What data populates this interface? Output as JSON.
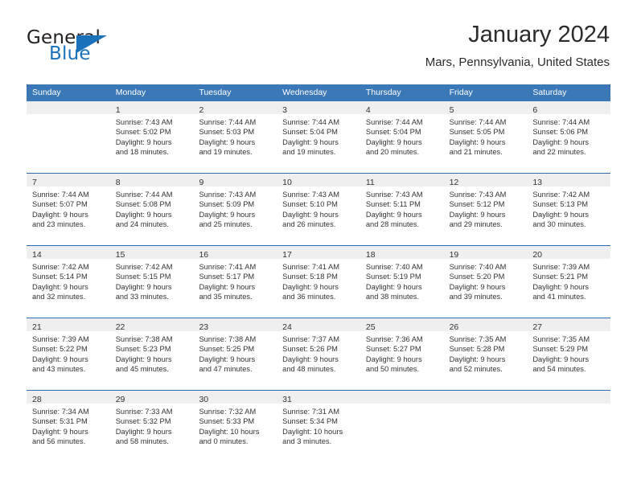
{
  "brand": {
    "name_top": "General",
    "name_bottom": "Blue",
    "triangle_icon": "triangle-icon",
    "accent_color": "#1b72bb"
  },
  "header": {
    "title": "January 2024",
    "subtitle": "Mars, Pennsylvania, United States"
  },
  "calendar": {
    "header_bg": "#3b78b8",
    "daynum_bg": "#efefef",
    "row_separator": "#2f6fb0",
    "weekdays": [
      "Sunday",
      "Monday",
      "Tuesday",
      "Wednesday",
      "Thursday",
      "Friday",
      "Saturday"
    ],
    "weeks": [
      [
        {
          "day": ""
        },
        {
          "day": "1",
          "sunrise": "Sunrise: 7:43 AM",
          "sunset": "Sunset: 5:02 PM",
          "daylight1": "Daylight: 9 hours",
          "daylight2": "and 18 minutes."
        },
        {
          "day": "2",
          "sunrise": "Sunrise: 7:44 AM",
          "sunset": "Sunset: 5:03 PM",
          "daylight1": "Daylight: 9 hours",
          "daylight2": "and 19 minutes."
        },
        {
          "day": "3",
          "sunrise": "Sunrise: 7:44 AM",
          "sunset": "Sunset: 5:04 PM",
          "daylight1": "Daylight: 9 hours",
          "daylight2": "and 19 minutes."
        },
        {
          "day": "4",
          "sunrise": "Sunrise: 7:44 AM",
          "sunset": "Sunset: 5:04 PM",
          "daylight1": "Daylight: 9 hours",
          "daylight2": "and 20 minutes."
        },
        {
          "day": "5",
          "sunrise": "Sunrise: 7:44 AM",
          "sunset": "Sunset: 5:05 PM",
          "daylight1": "Daylight: 9 hours",
          "daylight2": "and 21 minutes."
        },
        {
          "day": "6",
          "sunrise": "Sunrise: 7:44 AM",
          "sunset": "Sunset: 5:06 PM",
          "daylight1": "Daylight: 9 hours",
          "daylight2": "and 22 minutes."
        }
      ],
      [
        {
          "day": "7",
          "sunrise": "Sunrise: 7:44 AM",
          "sunset": "Sunset: 5:07 PM",
          "daylight1": "Daylight: 9 hours",
          "daylight2": "and 23 minutes."
        },
        {
          "day": "8",
          "sunrise": "Sunrise: 7:44 AM",
          "sunset": "Sunset: 5:08 PM",
          "daylight1": "Daylight: 9 hours",
          "daylight2": "and 24 minutes."
        },
        {
          "day": "9",
          "sunrise": "Sunrise: 7:43 AM",
          "sunset": "Sunset: 5:09 PM",
          "daylight1": "Daylight: 9 hours",
          "daylight2": "and 25 minutes."
        },
        {
          "day": "10",
          "sunrise": "Sunrise: 7:43 AM",
          "sunset": "Sunset: 5:10 PM",
          "daylight1": "Daylight: 9 hours",
          "daylight2": "and 26 minutes."
        },
        {
          "day": "11",
          "sunrise": "Sunrise: 7:43 AM",
          "sunset": "Sunset: 5:11 PM",
          "daylight1": "Daylight: 9 hours",
          "daylight2": "and 28 minutes."
        },
        {
          "day": "12",
          "sunrise": "Sunrise: 7:43 AM",
          "sunset": "Sunset: 5:12 PM",
          "daylight1": "Daylight: 9 hours",
          "daylight2": "and 29 minutes."
        },
        {
          "day": "13",
          "sunrise": "Sunrise: 7:42 AM",
          "sunset": "Sunset: 5:13 PM",
          "daylight1": "Daylight: 9 hours",
          "daylight2": "and 30 minutes."
        }
      ],
      [
        {
          "day": "14",
          "sunrise": "Sunrise: 7:42 AM",
          "sunset": "Sunset: 5:14 PM",
          "daylight1": "Daylight: 9 hours",
          "daylight2": "and 32 minutes."
        },
        {
          "day": "15",
          "sunrise": "Sunrise: 7:42 AM",
          "sunset": "Sunset: 5:15 PM",
          "daylight1": "Daylight: 9 hours",
          "daylight2": "and 33 minutes."
        },
        {
          "day": "16",
          "sunrise": "Sunrise: 7:41 AM",
          "sunset": "Sunset: 5:17 PM",
          "daylight1": "Daylight: 9 hours",
          "daylight2": "and 35 minutes."
        },
        {
          "day": "17",
          "sunrise": "Sunrise: 7:41 AM",
          "sunset": "Sunset: 5:18 PM",
          "daylight1": "Daylight: 9 hours",
          "daylight2": "and 36 minutes."
        },
        {
          "day": "18",
          "sunrise": "Sunrise: 7:40 AM",
          "sunset": "Sunset: 5:19 PM",
          "daylight1": "Daylight: 9 hours",
          "daylight2": "and 38 minutes."
        },
        {
          "day": "19",
          "sunrise": "Sunrise: 7:40 AM",
          "sunset": "Sunset: 5:20 PM",
          "daylight1": "Daylight: 9 hours",
          "daylight2": "and 39 minutes."
        },
        {
          "day": "20",
          "sunrise": "Sunrise: 7:39 AM",
          "sunset": "Sunset: 5:21 PM",
          "daylight1": "Daylight: 9 hours",
          "daylight2": "and 41 minutes."
        }
      ],
      [
        {
          "day": "21",
          "sunrise": "Sunrise: 7:39 AM",
          "sunset": "Sunset: 5:22 PM",
          "daylight1": "Daylight: 9 hours",
          "daylight2": "and 43 minutes."
        },
        {
          "day": "22",
          "sunrise": "Sunrise: 7:38 AM",
          "sunset": "Sunset: 5:23 PM",
          "daylight1": "Daylight: 9 hours",
          "daylight2": "and 45 minutes."
        },
        {
          "day": "23",
          "sunrise": "Sunrise: 7:38 AM",
          "sunset": "Sunset: 5:25 PM",
          "daylight1": "Daylight: 9 hours",
          "daylight2": "and 47 minutes."
        },
        {
          "day": "24",
          "sunrise": "Sunrise: 7:37 AM",
          "sunset": "Sunset: 5:26 PM",
          "daylight1": "Daylight: 9 hours",
          "daylight2": "and 48 minutes."
        },
        {
          "day": "25",
          "sunrise": "Sunrise: 7:36 AM",
          "sunset": "Sunset: 5:27 PM",
          "daylight1": "Daylight: 9 hours",
          "daylight2": "and 50 minutes."
        },
        {
          "day": "26",
          "sunrise": "Sunrise: 7:35 AM",
          "sunset": "Sunset: 5:28 PM",
          "daylight1": "Daylight: 9 hours",
          "daylight2": "and 52 minutes."
        },
        {
          "day": "27",
          "sunrise": "Sunrise: 7:35 AM",
          "sunset": "Sunset: 5:29 PM",
          "daylight1": "Daylight: 9 hours",
          "daylight2": "and 54 minutes."
        }
      ],
      [
        {
          "day": "28",
          "sunrise": "Sunrise: 7:34 AM",
          "sunset": "Sunset: 5:31 PM",
          "daylight1": "Daylight: 9 hours",
          "daylight2": "and 56 minutes."
        },
        {
          "day": "29",
          "sunrise": "Sunrise: 7:33 AM",
          "sunset": "Sunset: 5:32 PM",
          "daylight1": "Daylight: 9 hours",
          "daylight2": "and 58 minutes."
        },
        {
          "day": "30",
          "sunrise": "Sunrise: 7:32 AM",
          "sunset": "Sunset: 5:33 PM",
          "daylight1": "Daylight: 10 hours",
          "daylight2": "and 0 minutes."
        },
        {
          "day": "31",
          "sunrise": "Sunrise: 7:31 AM",
          "sunset": "Sunset: 5:34 PM",
          "daylight1": "Daylight: 10 hours",
          "daylight2": "and 3 minutes."
        },
        {
          "day": ""
        },
        {
          "day": ""
        },
        {
          "day": ""
        }
      ]
    ]
  }
}
